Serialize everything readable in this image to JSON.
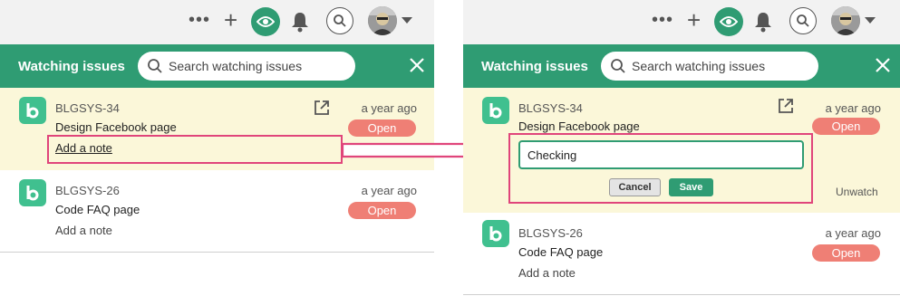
{
  "colors": {
    "brand_green": "#2f9c73",
    "logo_green": "#40c08f",
    "highlight_bg": "#fbf7d9",
    "badge_open": "#ef7f75",
    "annotation_pink": "#e0457b"
  },
  "nav": {
    "more_icon": "more-dots-icon",
    "add_icon": "plus-icon",
    "watch_icon": "eye-icon",
    "notify_icon": "bell-icon",
    "search_icon": "search-icon",
    "profile_caret": "chevron-down-icon"
  },
  "header": {
    "title": "Watching issues",
    "search_placeholder": "Search watching issues",
    "close_icon": "close-icon"
  },
  "left": {
    "issues": [
      {
        "key": "BLGSYS-34",
        "title": "Design Facebook page",
        "time": "a year ago",
        "status": "Open",
        "note_link": "Add a note"
      },
      {
        "key": "BLGSYS-26",
        "title": "Code FAQ page",
        "time": "a year ago",
        "status": "Open",
        "note_link": "Add a note"
      }
    ]
  },
  "right": {
    "issues": [
      {
        "key": "BLGSYS-34",
        "title": "Design Facebook page",
        "time": "a year ago",
        "status": "Open",
        "note_value": "Checking",
        "cancel_label": "Cancel",
        "save_label": "Save",
        "unwatch_label": "Unwatch"
      },
      {
        "key": "BLGSYS-26",
        "title": "Code FAQ page",
        "time": "a year ago",
        "status": "Open",
        "note_link": "Add a note"
      }
    ]
  }
}
